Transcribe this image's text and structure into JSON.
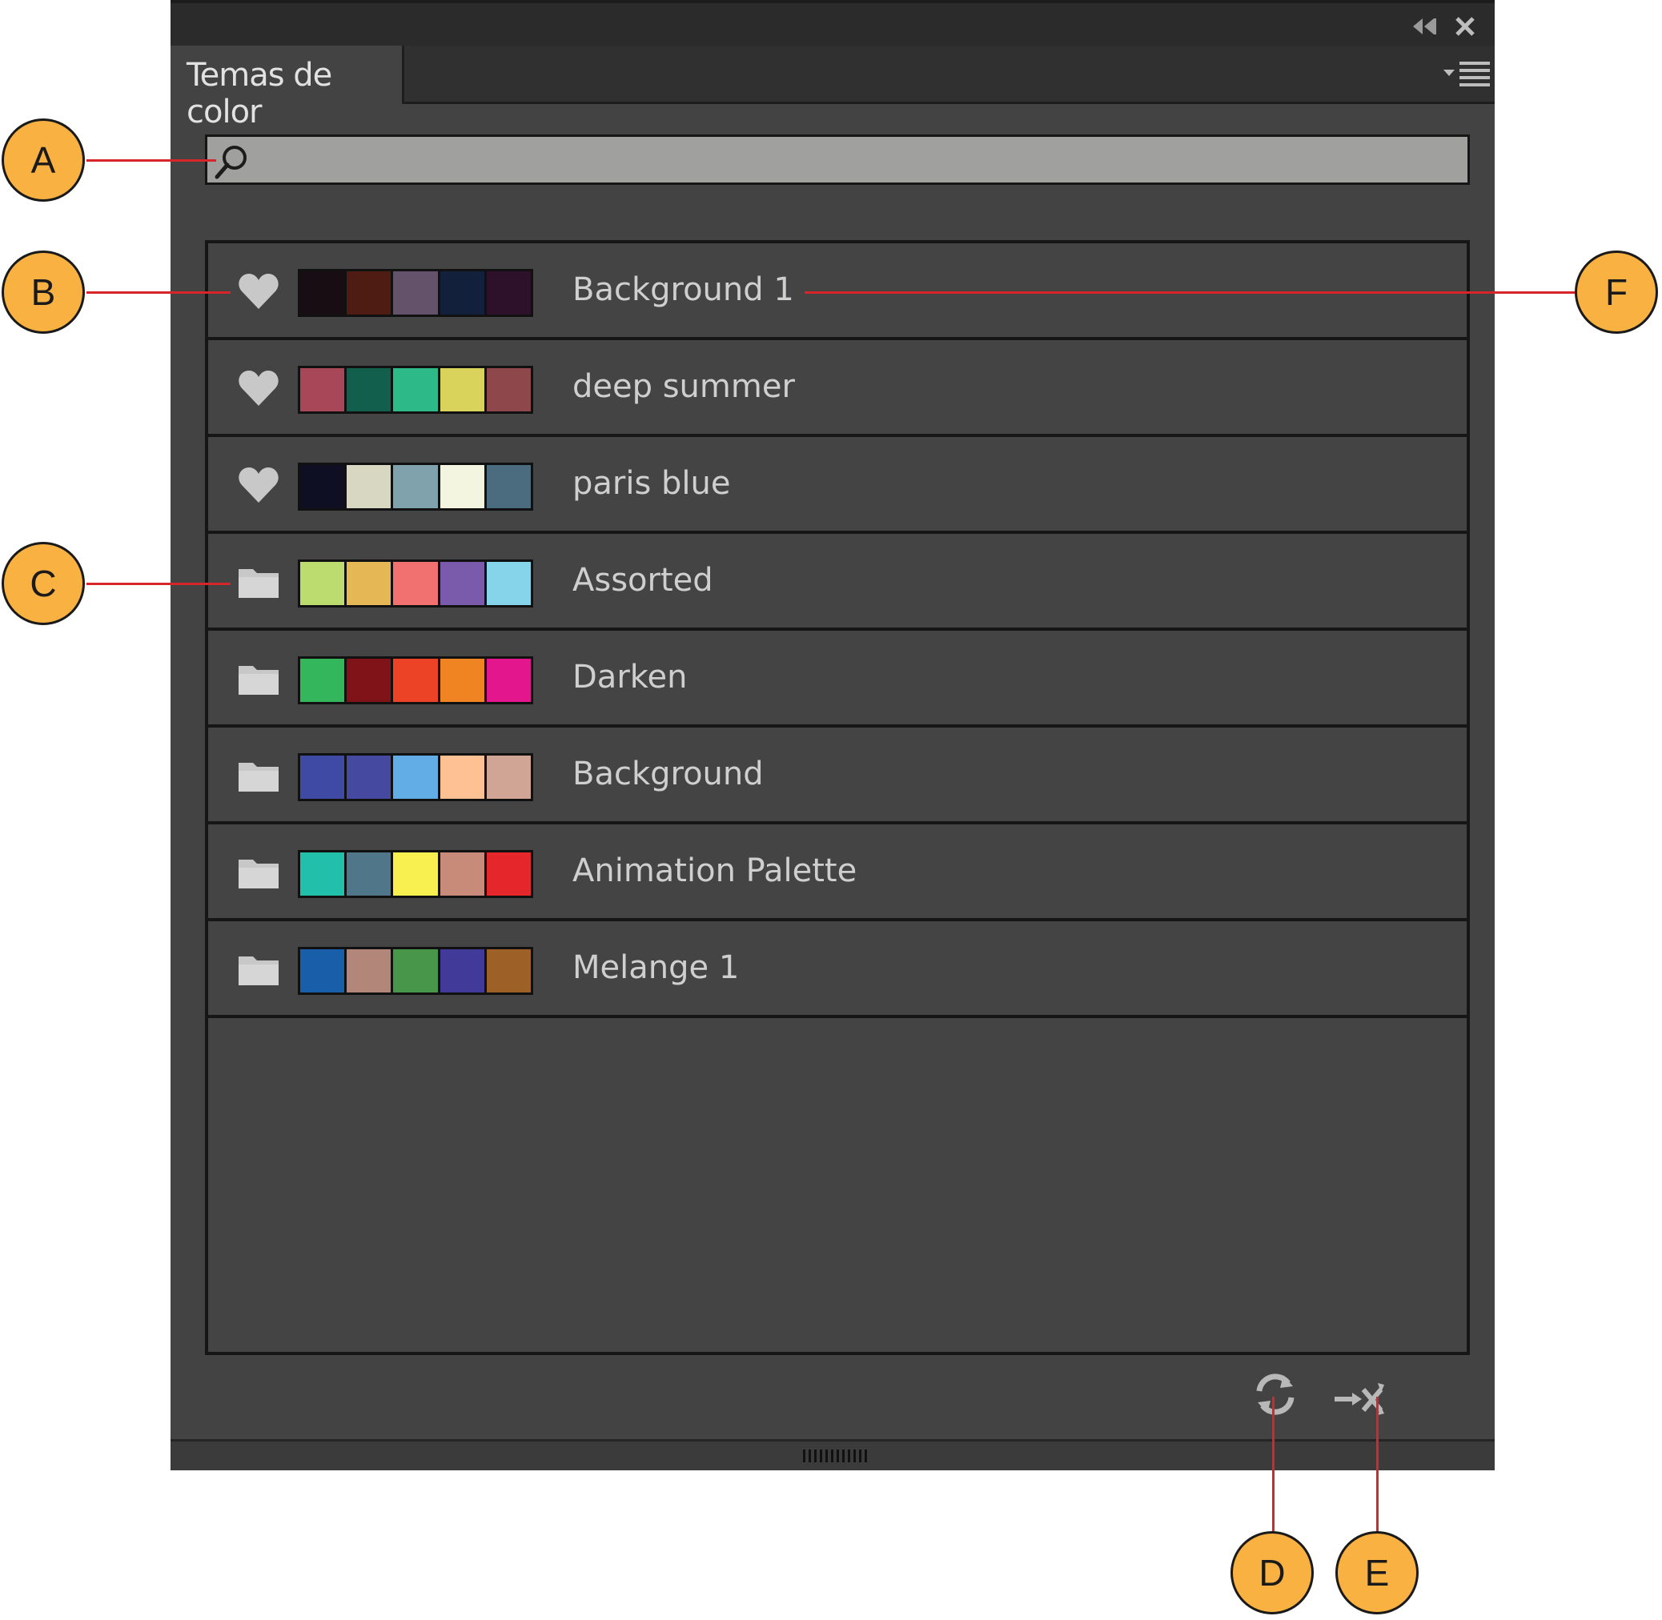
{
  "panel": {
    "tab_title": "Temas de color",
    "search": {
      "placeholder": "",
      "value": ""
    },
    "icons": {
      "collapse": "collapse-double-arrow-icon",
      "close": "close-icon",
      "menu": "panel-menu-icon",
      "search": "search-icon",
      "favorite": "heart-icon",
      "library": "folder-icon",
      "refresh": "refresh-icon",
      "shuffle": "shuffle-icon",
      "grip": "resize-grip-icon"
    },
    "themes": [
      {
        "name": "Background 1",
        "type": "favorite",
        "colors": [
          "#190d14",
          "#4f1c13",
          "#63526a",
          "#12203b",
          "#2d112a"
        ]
      },
      {
        "name": "deep summer",
        "type": "favorite",
        "colors": [
          "#a74758",
          "#125f4e",
          "#2eb989",
          "#d9d35b",
          "#8e474a"
        ]
      },
      {
        "name": "paris blue",
        "type": "favorite",
        "colors": [
          "#0f0f23",
          "#d8d8c2",
          "#7fa2ad",
          "#f4f5e1",
          "#4b6c7e"
        ]
      },
      {
        "name": "Assorted",
        "type": "library",
        "colors": [
          "#bddc6f",
          "#e6b855",
          "#f07170",
          "#7a5aab",
          "#85d4e9"
        ]
      },
      {
        "name": "Darken",
        "type": "library",
        "colors": [
          "#33b65c",
          "#7f1317",
          "#ec4327",
          "#f08423",
          "#e3168e"
        ]
      },
      {
        "name": "Background",
        "type": "library",
        "colors": [
          "#3e4aa3",
          "#454aa0",
          "#63ade6",
          "#fdc193",
          "#d0a595"
        ]
      },
      {
        "name": "Animation Palette",
        "type": "library",
        "colors": [
          "#22bfab",
          "#507689",
          "#f7f050",
          "#c88b79",
          "#e5262b"
        ]
      },
      {
        "name": "Melange 1",
        "type": "library",
        "colors": [
          "#185ea8",
          "#b28679",
          "#48964a",
          "#423a98",
          "#9d6127"
        ]
      }
    ]
  },
  "callouts": {
    "a": "A",
    "b": "B",
    "c": "C",
    "d": "D",
    "e": "E",
    "f": "F"
  },
  "colors": {
    "accent": "#f9b241",
    "leader_line": "#d6262c",
    "panel_bg": "#424342"
  }
}
